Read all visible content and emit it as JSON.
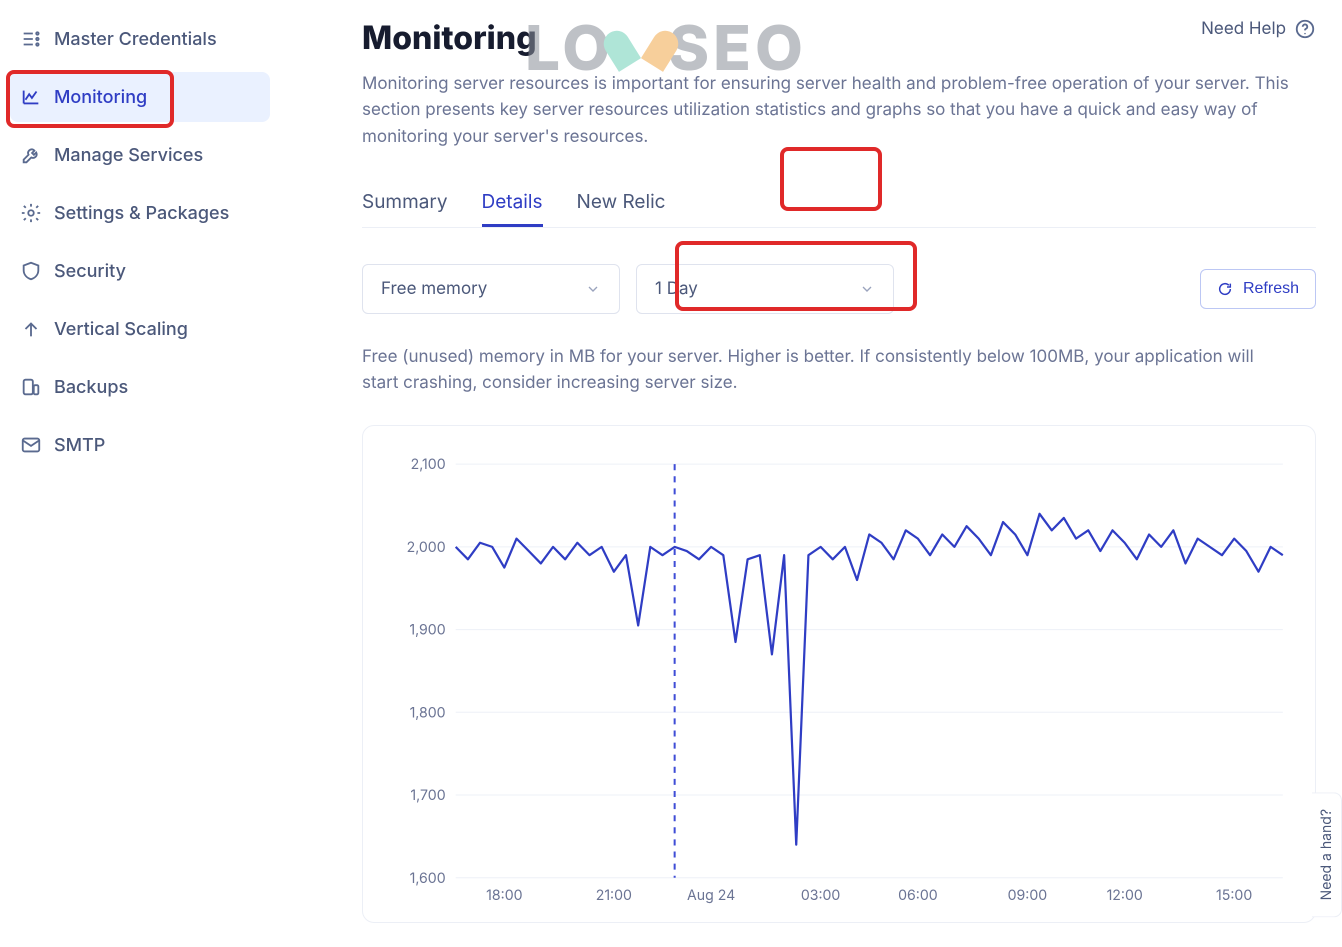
{
  "colors": {
    "accent": "#2f3dc4",
    "highlight": "#e02929",
    "text": "#1f2a44",
    "muted": "#6b7494",
    "grid": "#edf0f7"
  },
  "watermark": {
    "left": "LO",
    "right": "SEO"
  },
  "sidebar": {
    "active_index": 1,
    "items": [
      {
        "label": "Master Credentials",
        "icon": "list-icon"
      },
      {
        "label": "Monitoring",
        "icon": "chart-line-icon"
      },
      {
        "label": "Manage Services",
        "icon": "wrench-icon"
      },
      {
        "label": "Settings & Packages",
        "icon": "gear-icon"
      },
      {
        "label": "Security",
        "icon": "shield-icon"
      },
      {
        "label": "Vertical Scaling",
        "icon": "arrow-up-icon"
      },
      {
        "label": "Backups",
        "icon": "database-icon"
      },
      {
        "label": "SMTP",
        "icon": "mail-icon"
      }
    ]
  },
  "header": {
    "title": "Monitoring",
    "description": "Monitoring server resources is important for ensuring server health and problem-free operation of your server. This section presents key server resources utilization statistics and graphs so that you have a quick and easy way of monitoring your server's resources.",
    "help_label": "Need Help"
  },
  "tabs": {
    "items": [
      {
        "label": "Summary"
      },
      {
        "label": "Details"
      },
      {
        "label": "New Relic"
      }
    ],
    "active_index": 1
  },
  "controls": {
    "metric_select": "Free memory",
    "range_select": "1 Day",
    "refresh_label": "Refresh"
  },
  "metric_description": "Free (unused) memory in MB for your server. Higher is better. If consistently below 100MB, your application will start crashing, consider increasing server size.",
  "chart_data": {
    "type": "line",
    "title": "",
    "xlabel": "",
    "ylabel": "",
    "ylim": [
      1600,
      2100
    ],
    "y_ticks": [
      2100,
      2000,
      1900,
      1800,
      1700,
      1600
    ],
    "x_ticks": [
      "18:00",
      "21:00",
      "Aug 24",
      "03:00",
      "06:00",
      "09:00",
      "12:00",
      "15:00"
    ],
    "series": [
      {
        "name": "Free memory (MB)",
        "color": "#2f3dc4",
        "x": [
          "17:00",
          "17:20",
          "17:40",
          "18:00",
          "18:20",
          "18:40",
          "19:00",
          "19:20",
          "19:40",
          "20:00",
          "20:20",
          "20:40",
          "21:00",
          "21:20",
          "21:40",
          "22:00",
          "22:20",
          "22:40",
          "23:00",
          "23:10",
          "23:20",
          "23:40",
          "00:00",
          "00:20",
          "00:30",
          "00:40",
          "01:00",
          "01:20",
          "01:30",
          "01:40",
          "02:00",
          "02:20",
          "02:40",
          "03:00",
          "03:30",
          "04:00",
          "04:20",
          "04:40",
          "05:00",
          "05:20",
          "05:40",
          "06:00",
          "06:20",
          "06:40",
          "07:00",
          "07:30",
          "08:00",
          "08:20",
          "08:40",
          "09:00",
          "09:20",
          "09:40",
          "10:00",
          "10:20",
          "10:40",
          "11:00",
          "11:20",
          "11:40",
          "12:00",
          "12:20",
          "12:40",
          "13:00",
          "13:30",
          "14:00",
          "14:30",
          "15:00",
          "15:20",
          "15:40",
          "16:00"
        ],
        "values": [
          2000,
          1985,
          2005,
          2000,
          1975,
          2010,
          1995,
          1980,
          2000,
          1985,
          2005,
          1990,
          2000,
          1970,
          1990,
          1905,
          2000,
          1990,
          2000,
          1995,
          1985,
          2000,
          1990,
          1885,
          1985,
          1990,
          1870,
          1990,
          1640,
          1990,
          2000,
          1985,
          2000,
          1960,
          2015,
          2005,
          1985,
          2020,
          2010,
          1990,
          2015,
          2000,
          2025,
          2010,
          1990,
          2030,
          2015,
          1990,
          2040,
          2020,
          2035,
          2010,
          2020,
          1995,
          2020,
          2005,
          1985,
          2015,
          2000,
          2020,
          1980,
          2010,
          2000,
          1990,
          2010,
          1995,
          1970,
          2000,
          1990
        ]
      }
    ],
    "marker_x": "23:00"
  },
  "hand_tab": {
    "label": "Need a hand?"
  }
}
